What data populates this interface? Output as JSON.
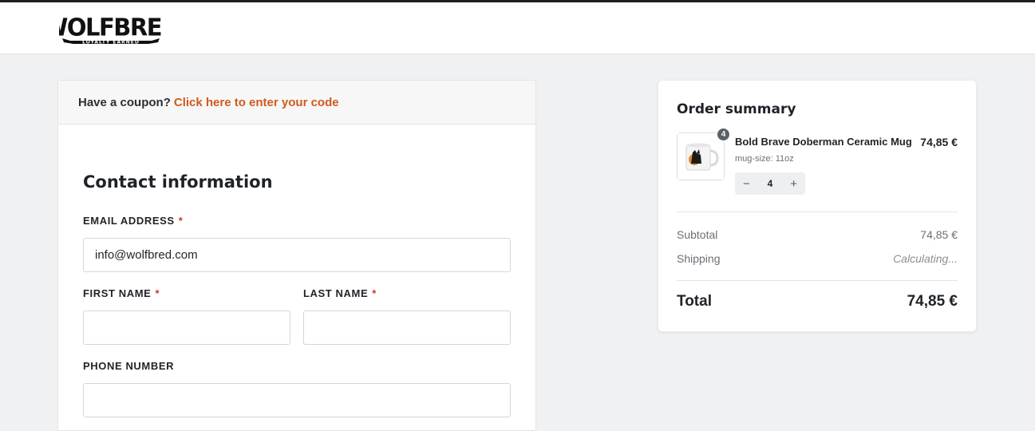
{
  "brand": {
    "name": "WOLFBRED",
    "tagline": "LOYALTY EARNED"
  },
  "coupon": {
    "prompt": "Have a coupon?",
    "link": "Click here to enter your code"
  },
  "contact": {
    "title": "Contact information",
    "email_label": "EMAIL ADDRESS",
    "email_value": "info@wolfbred.com",
    "first_name_label": "FIRST NAME",
    "first_name_value": "",
    "last_name_label": "LAST NAME",
    "last_name_value": "",
    "phone_label": "PHONE NUMBER",
    "phone_value": "",
    "required_marker": "*"
  },
  "summary": {
    "title": "Order summary",
    "item": {
      "name": "Bold Brave Doberman Ceramic Mug",
      "variant": "mug-size: 11oz",
      "price": "74,85 €",
      "quantity": "4",
      "badge": "4",
      "minus": "−",
      "plus": "+"
    },
    "subtotal_label": "Subtotal",
    "subtotal_value": "74,85 €",
    "shipping_label": "Shipping",
    "shipping_value": "Calculating...",
    "total_label": "Total",
    "total_value": "74,85 €"
  },
  "colors": {
    "accent": "#d05a1e",
    "required": "#d0342c",
    "background": "#f0f1f3"
  },
  "icons": [
    "wolfbred-logo",
    "product-thumbnail-mug",
    "minus-icon",
    "plus-icon"
  ]
}
